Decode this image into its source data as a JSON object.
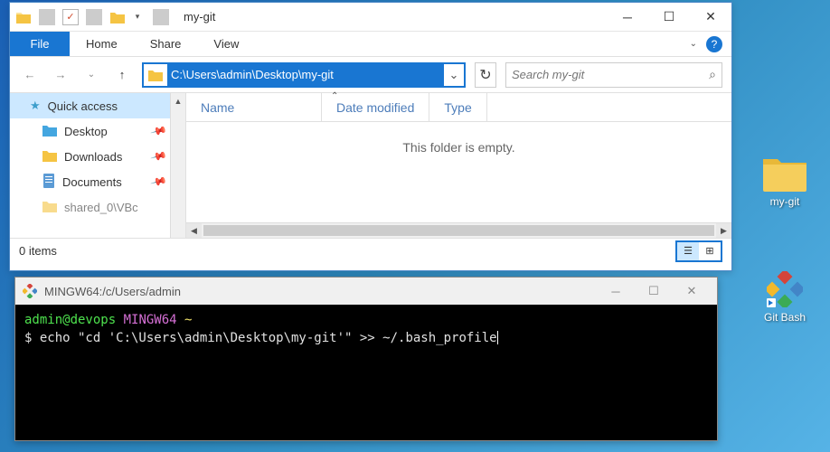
{
  "explorer": {
    "title": "my-git",
    "ribbon": {
      "file": "File",
      "home": "Home",
      "share": "Share",
      "view": "View"
    },
    "address": "C:\\Users\\admin\\Desktop\\my-git",
    "search_placeholder": "Search my-git",
    "sidebar": {
      "quick_access": "Quick access",
      "items": [
        {
          "label": "Desktop"
        },
        {
          "label": "Downloads"
        },
        {
          "label": "Documents"
        },
        {
          "label": "shared_0\\VBc"
        }
      ]
    },
    "columns": {
      "name": "Name",
      "date": "Date modified",
      "type": "Type"
    },
    "empty": "This folder is empty.",
    "status": "0 items"
  },
  "terminal": {
    "title": "MINGW64:/c/Users/admin",
    "prompt_user": "admin@devops",
    "prompt_env": "MINGW64",
    "prompt_path": "~",
    "command": "echo \"cd 'C:\\Users\\admin\\Desktop\\my-git'\" >> ~/.bash_profile"
  },
  "desktop": {
    "folder": "my-git",
    "gitbash": "Git Bash"
  }
}
